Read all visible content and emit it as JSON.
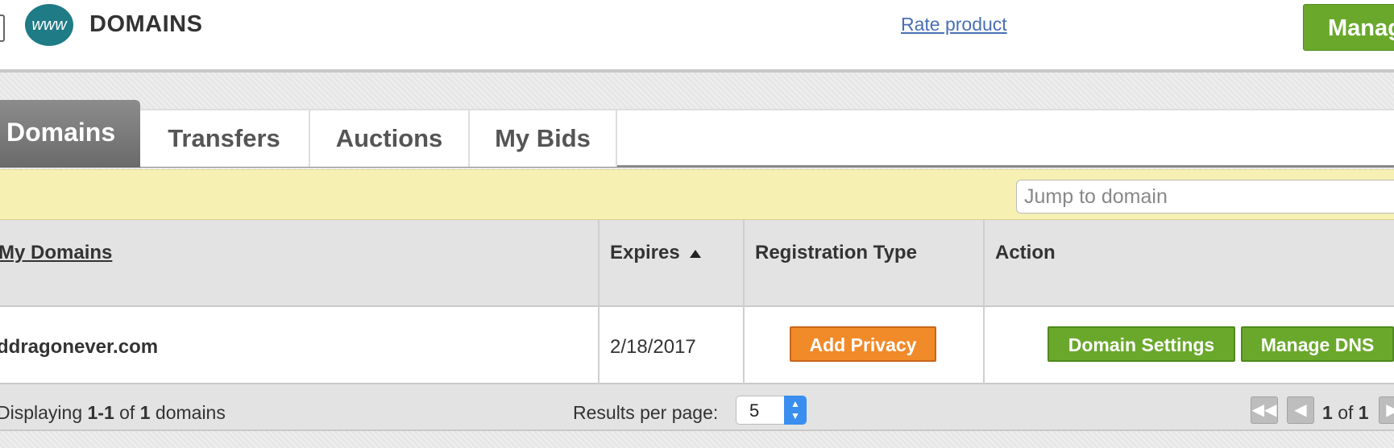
{
  "header": {
    "icon_text": "www",
    "title": "DOMAINS",
    "rate_link": "Rate product",
    "manage_button": "Manag"
  },
  "tabs": [
    {
      "label": "Domains",
      "active": true
    },
    {
      "label": "Transfers",
      "active": false
    },
    {
      "label": "Auctions",
      "active": false
    },
    {
      "label": "My Bids",
      "active": false
    }
  ],
  "search": {
    "placeholder": "Jump to domain",
    "value": ""
  },
  "table": {
    "columns": [
      "My Domains",
      "Expires",
      "Registration Type",
      "Action"
    ],
    "sort": {
      "column": "Expires",
      "direction": "ascending"
    },
    "rows": [
      {
        "domain": "ddragonever.com",
        "expires": "2/18/2017",
        "registration_button": "Add Privacy",
        "actions": [
          "Domain Settings",
          "Manage DNS"
        ]
      }
    ]
  },
  "footer": {
    "displaying_prefix": "Displaying",
    "range": "1-1",
    "of_word": "of",
    "total": "1",
    "suffix": "domains",
    "results_per_page_label": "Results per page:",
    "results_per_page_value": "5",
    "page_current": "1",
    "page_of": "of",
    "page_total": "1"
  },
  "colors": {
    "accent_green": "#6aa82c",
    "accent_orange": "#f18a29",
    "highlight_yellow": "#f6f0b3",
    "brand_teal": "#1f7b86",
    "link_blue": "#4a6fb5"
  },
  "icons": [
    "www-globe-icon",
    "sort-ascending-icon",
    "first-page-icon",
    "previous-page-icon",
    "next-page-icon"
  ]
}
